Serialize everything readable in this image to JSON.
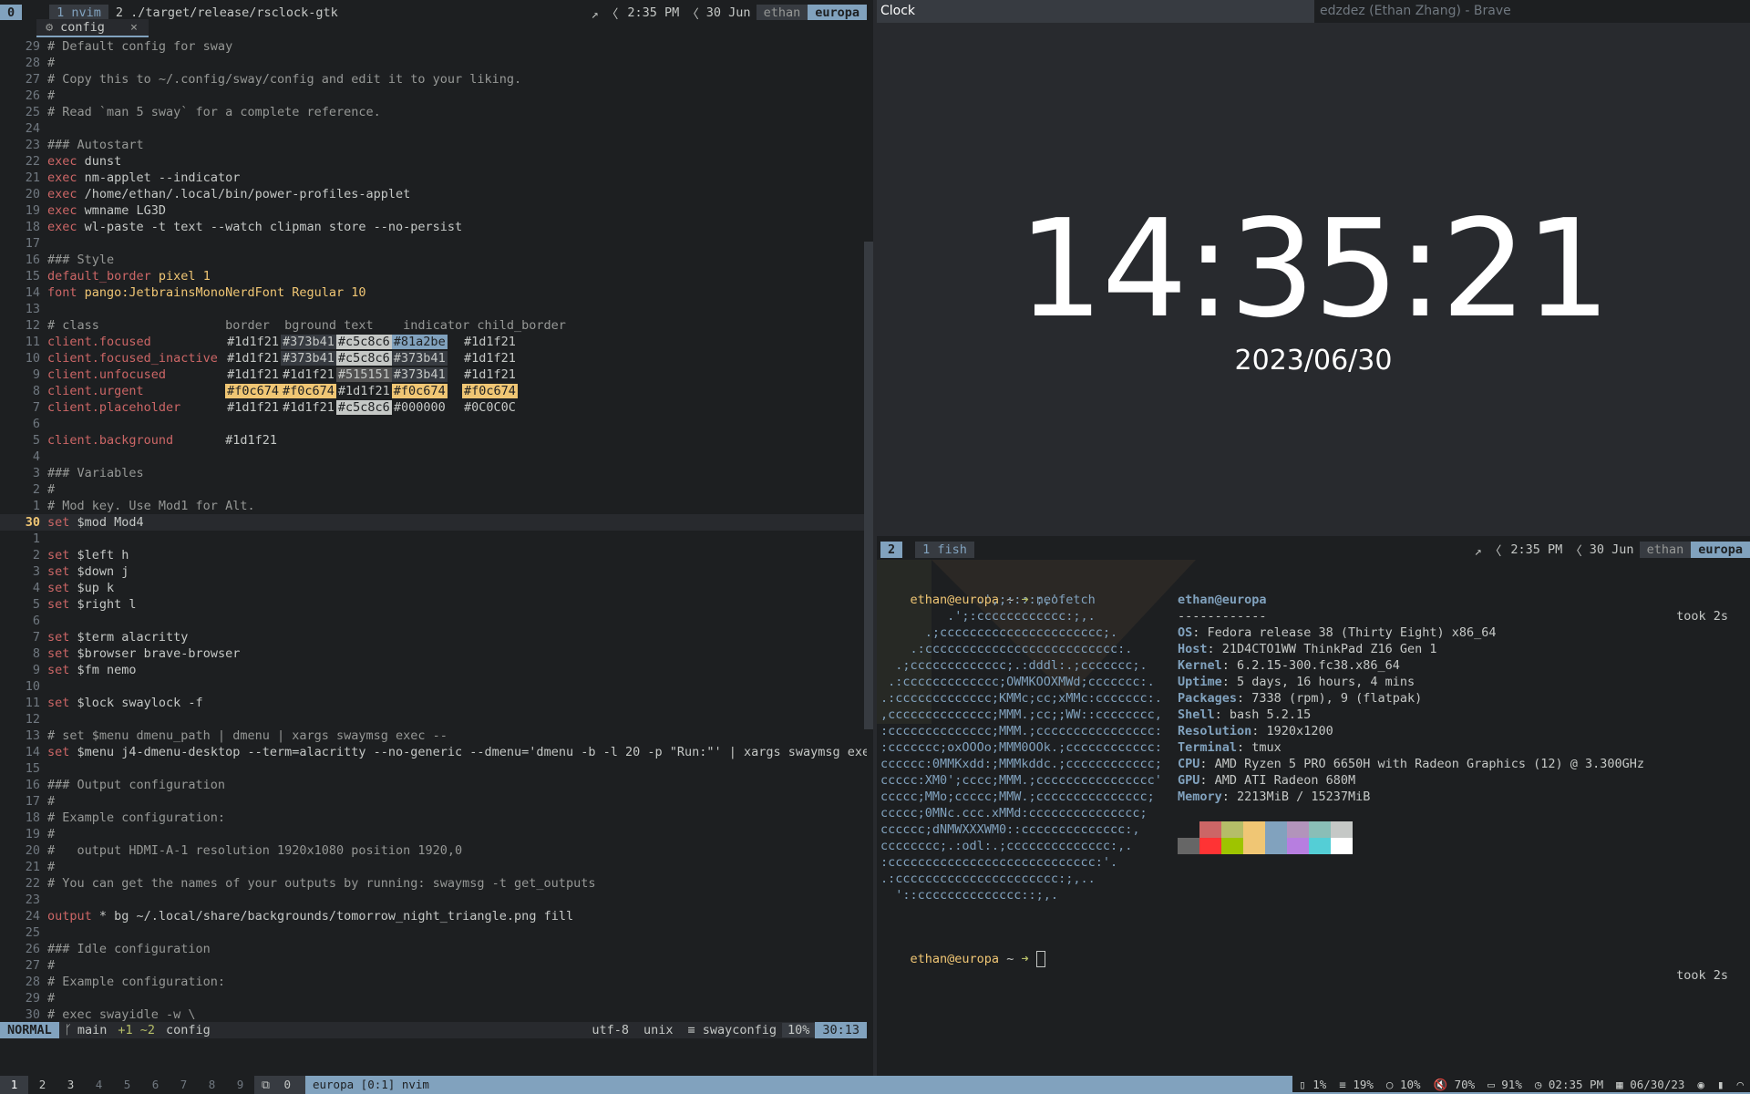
{
  "left_tmux": {
    "session": "0",
    "win1": "1 nvim",
    "win2": "2 ./target/release/rsclock-gtk",
    "time": "2:35 PM",
    "date": "30 Jun",
    "user": "ethan",
    "host": "europa"
  },
  "buffer_tab": {
    "icon": "gear-icon",
    "name": "config",
    "close": "×"
  },
  "code_lines": [
    {
      "n": "29",
      "t": "# Default config for sway",
      "c": "cm"
    },
    {
      "n": "28",
      "t": "#",
      "c": "cm"
    },
    {
      "n": "27",
      "t": "# Copy this to ~/.config/sway/config and edit it to your liking.",
      "c": "cm"
    },
    {
      "n": "26",
      "t": "#",
      "c": "cm"
    },
    {
      "n": "25",
      "t": "# Read `man 5 sway` for a complete reference.",
      "c": "cm"
    },
    {
      "n": "24",
      "t": "",
      "c": "txt"
    },
    {
      "n": "23",
      "t": "### Autostart",
      "c": "cm"
    },
    {
      "n": "22",
      "k": "exec",
      "t": " dunst",
      "c": "txt"
    },
    {
      "n": "21",
      "k": "exec",
      "t": " nm-applet --indicator",
      "c": "txt"
    },
    {
      "n": "20",
      "k": "exec",
      "t": " /home/ethan/.local/bin/power-profiles-applet",
      "c": "txt"
    },
    {
      "n": "19",
      "k": "exec",
      "t": " wmname LG3D",
      "c": "txt"
    },
    {
      "n": "18",
      "k": "exec",
      "t": " wl-paste -t text --watch clipman store --no-persist",
      "c": "txt"
    },
    {
      "n": "17",
      "t": "",
      "c": "txt"
    },
    {
      "n": "16",
      "t": "### Style",
      "c": "cm"
    },
    {
      "n": "15",
      "k": "default_border",
      "t": " pixel 1",
      "c": "ty"
    },
    {
      "n": "14",
      "k": "font",
      "t": " pango:JetbrainsMonoNerdFont Regular 10",
      "c": "ty"
    },
    {
      "n": "13",
      "t": "",
      "c": "txt"
    },
    {
      "n": "12",
      "t": "# class                 border  bground text    indicator child_border",
      "c": "cm"
    },
    {
      "n": "11",
      "k": "client.focused",
      "t": "",
      "c": "txt"
    },
    {
      "n": "10",
      "k": "client.focused_inactive",
      "t": "",
      "c": "txt"
    },
    {
      "n": "9",
      "k": "client.unfocused",
      "t": "",
      "c": "txt"
    },
    {
      "n": "8",
      "k": "client.urgent",
      "t": "",
      "c": "txt"
    },
    {
      "n": "7",
      "k": "client.placeholder",
      "t": "",
      "c": "txt"
    },
    {
      "n": "6",
      "t": "",
      "c": "txt"
    },
    {
      "n": "5",
      "k": "client.background",
      "t": "       #1d1f21",
      "c": "txt"
    },
    {
      "n": "4",
      "t": "",
      "c": "txt"
    },
    {
      "n": "3",
      "t": "### Variables",
      "c": "cm"
    },
    {
      "n": "2",
      "t": "#",
      "c": "cm"
    },
    {
      "n": "1",
      "t": "# Mod key. Use Mod1 for Alt.",
      "c": "cm"
    },
    {
      "n": "30",
      "k": "set",
      "t": " $mod Mod4",
      "c": "txt",
      "cur": true
    },
    {
      "n": "1",
      "t": "",
      "c": "txt"
    },
    {
      "n": "2",
      "k": "set",
      "t": " $left h",
      "c": "txt"
    },
    {
      "n": "3",
      "k": "set",
      "t": " $down j",
      "c": "txt"
    },
    {
      "n": "4",
      "k": "set",
      "t": " $up k",
      "c": "txt"
    },
    {
      "n": "5",
      "k": "set",
      "t": " $right l",
      "c": "txt"
    },
    {
      "n": "6",
      "t": "",
      "c": "txt"
    },
    {
      "n": "7",
      "k": "set",
      "t": " $term alacritty",
      "c": "txt"
    },
    {
      "n": "8",
      "k": "set",
      "t": " $browser brave-browser",
      "c": "txt"
    },
    {
      "n": "9",
      "k": "set",
      "t": " $fm nemo",
      "c": "txt"
    },
    {
      "n": "10",
      "t": "",
      "c": "txt"
    },
    {
      "n": "11",
      "k": "set",
      "t": " $lock swaylock -f",
      "c": "txt"
    },
    {
      "n": "12",
      "t": "",
      "c": "txt"
    },
    {
      "n": "13",
      "t": "# set $menu dmenu_path | dmenu | xargs swaymsg exec --",
      "c": "cm"
    },
    {
      "n": "14",
      "k": "set",
      "t": " $menu j4-dmenu-desktop --term=alacritty --no-generic --dmenu='dmenu -b -l 20 -p \"Run:\"' | xargs swaymsg exec",
      "c": "txt"
    },
    {
      "n": "15",
      "t": "",
      "c": "txt"
    },
    {
      "n": "16",
      "t": "### Output configuration",
      "c": "cm"
    },
    {
      "n": "17",
      "t": "#",
      "c": "cm"
    },
    {
      "n": "18",
      "t": "# Example configuration:",
      "c": "cm"
    },
    {
      "n": "19",
      "t": "#",
      "c": "cm"
    },
    {
      "n": "20",
      "t": "#   output HDMI-A-1 resolution 1920x1080 position 1920,0",
      "c": "cm"
    },
    {
      "n": "21",
      "t": "#",
      "c": "cm"
    },
    {
      "n": "22",
      "t": "# You can get the names of your outputs by running: swaymsg -t get_outputs",
      "c": "cm"
    },
    {
      "n": "23",
      "t": "",
      "c": "txt"
    },
    {
      "n": "24",
      "k": "output",
      "t": " * bg ~/.local/share/backgrounds/tomorrow_night_triangle.png fill",
      "c": "txt"
    },
    {
      "n": "25",
      "t": "",
      "c": "txt"
    },
    {
      "n": "26",
      "t": "### Idle configuration",
      "c": "cm"
    },
    {
      "n": "27",
      "t": "#",
      "c": "cm"
    },
    {
      "n": "28",
      "t": "# Example configuration:",
      "c": "cm"
    },
    {
      "n": "29",
      "t": "#",
      "c": "cm"
    },
    {
      "n": "30",
      "t": "# exec swayidle -w \\",
      "c": "cm"
    }
  ],
  "color_table": [
    {
      "row": "client.focused",
      "cols": [
        {
          "v": "#1d1f21"
        },
        {
          "v": "#373b41",
          "bg": "#373b41",
          "fg": "#c5c8c6"
        },
        {
          "v": "#c5c8c6",
          "bg": "#c5c8c6",
          "fg": "#1d1f21"
        },
        {
          "v": "#81a2be",
          "bg": "#81a2be",
          "fg": "#1d1f21"
        },
        {
          "v": "#1d1f21"
        }
      ]
    },
    {
      "row": "client.focused_inactive",
      "cols": [
        {
          "v": "#1d1f21"
        },
        {
          "v": "#373b41",
          "bg": "#373b41",
          "fg": "#c5c8c6"
        },
        {
          "v": "#c5c8c6",
          "bg": "#c5c8c6",
          "fg": "#1d1f21"
        },
        {
          "v": "#373b41",
          "bg": "#373b41",
          "fg": "#c5c8c6"
        },
        {
          "v": "#1d1f21"
        }
      ]
    },
    {
      "row": "client.unfocused",
      "cols": [
        {
          "v": "#1d1f21"
        },
        {
          "v": "#1d1f21"
        },
        {
          "v": "#515151",
          "bg": "#515151",
          "fg": "#c5c8c6"
        },
        {
          "v": "#373b41",
          "bg": "#373b41",
          "fg": "#c5c8c6"
        },
        {
          "v": "#1d1f21"
        }
      ]
    },
    {
      "row": "client.urgent",
      "cols": [
        {
          "v": "#f0c674",
          "bg": "#f0c674",
          "fg": "#1d1f21"
        },
        {
          "v": "#f0c674",
          "bg": "#f0c674",
          "fg": "#1d1f21"
        },
        {
          "v": "#1d1f21"
        },
        {
          "v": "#f0c674",
          "bg": "#f0c674",
          "fg": "#1d1f21"
        },
        {
          "v": "#f0c674",
          "bg": "#f0c674",
          "fg": "#1d1f21"
        }
      ]
    },
    {
      "row": "client.placeholder",
      "cols": [
        {
          "v": "#1d1f21"
        },
        {
          "v": "#1d1f21"
        },
        {
          "v": "#c5c8c6",
          "bg": "#c5c8c6",
          "fg": "#1d1f21"
        },
        {
          "v": "#000000"
        },
        {
          "v": "#0C0C0C"
        }
      ]
    }
  ],
  "statusline": {
    "mode": "NORMAL",
    "branch": "main",
    "diff": "+1 ~2",
    "file": "config",
    "encoding": "utf-8",
    "format": "unix",
    "filetype": "swayconfig",
    "percent": "10%",
    "position": "30:13"
  },
  "clock_window": {
    "title": "Clock",
    "other_title": "edzdez (Ethan Zhang) - Brave",
    "time": "14:35:21",
    "date": "2023/06/30"
  },
  "right_tmux": {
    "session": "2",
    "win1": "1 fish",
    "time": "2:35 PM",
    "date": "30 Jun",
    "user": "ethan",
    "host": "europa"
  },
  "terminal": {
    "prompt1_user": "ethan@europa",
    "prompt1_dir": " ~ ",
    "prompt1_cmd": "neofetch",
    "took": "took 2s",
    "ascii": [
      "             .',;::::;,'.",
      "         .';:cccccccccccc:;,.",
      "      .;cccccccccccccccccccccc;.",
      "    .:cccccccccccccccccccccccccc:.",
      "  .;ccccccccccccc;.:dddl:.;ccccccc;.",
      " .:ccccccccccccc;OWMKOOXMWd;ccccccc:.",
      ".:ccccccccccccc;KMMc;cc;xMMc:ccccccc:.",
      ",cccccccccccccc;MMM.;cc;;WW::cccccccc,",
      ":cccccccccccccc;MMM.;cccccccccccccccc:",
      ":ccccccc;oxOOOo;MMM0OOk.;cccccccccccc:",
      "cccccc:0MMKxdd:;MMMkddc.;cccccccccccc;",
      "ccccc:XM0';cccc;MMM.;cccccccccccccccc'",
      "ccccc;MMo;ccccc;MMW.;ccccccccccccccc;",
      "ccccc;0MNc.ccc.xMMd:ccccccccccccccc;",
      "cccccc;dNMWXXXWM0::cccccccccccccc:,",
      "cccccccc;.:odl:.;cccccccccccccc:,.",
      ":cccccccccccccccccccccccccccc:'.",
      ".:cccccccccccccccccccccc:;,..",
      "  '::cccccccccccccc::;,."
    ],
    "info_title": "ethan@europa",
    "info_sep": "------------",
    "info": [
      {
        "k": "OS",
        "v": " Fedora release 38 (Thirty Eight) x86_64"
      },
      {
        "k": "Host",
        "v": " 21D4CTO1WW ThinkPad Z16 Gen 1"
      },
      {
        "k": "Kernel",
        "v": " 6.2.15-300.fc38.x86_64"
      },
      {
        "k": "Uptime",
        "v": " 5 days, 16 hours, 4 mins"
      },
      {
        "k": "Packages",
        "v": " 7338 (rpm), 9 (flatpak)"
      },
      {
        "k": "Shell",
        "v": " bash 5.2.15"
      },
      {
        "k": "Resolution",
        "v": " 1920x1200"
      },
      {
        "k": "Terminal",
        "v": " tmux"
      },
      {
        "k": "CPU",
        "v": " AMD Ryzen 5 PRO 6650H with Radeon Graphics (12) @ 3.300GHz"
      },
      {
        "k": "GPU",
        "v": " AMD ATI Radeon 680M"
      },
      {
        "k": "Memory",
        "v": " 2213MiB / 15237MiB"
      }
    ],
    "palette_top": [
      "#1d1f21",
      "#cc6666",
      "#b5bd68",
      "#f0c674",
      "#81a2be",
      "#b294bb",
      "#8abeb7",
      "#c5c8c6"
    ],
    "palette_bottom": [
      "#666666",
      "#ff3334",
      "#9ec400",
      "#f0c674",
      "#81a2be",
      "#b77ee0",
      "#54ced6",
      "#ffffff"
    ],
    "prompt2_user": "ethan@europa",
    "prompt2_dir": " ~ ",
    "took2": "took 2s"
  },
  "swaybar": {
    "workspaces": [
      "1",
      "2",
      "3",
      "4",
      "5",
      "6",
      "7",
      "8",
      "9"
    ],
    "active_ws": "1",
    "tmux_icon": "window-icon",
    "tmux_num": "0",
    "tmux_text": "europa [0:1] nvim",
    "tray": [
      {
        "icon": "disk-icon",
        "v": "1%"
      },
      {
        "icon": "cpu-icon",
        "v": "19%"
      },
      {
        "icon": "memory-icon",
        "v": "10%"
      },
      {
        "icon": "speaker-mute-icon",
        "v": "70%"
      },
      {
        "icon": "battery-icon",
        "v": "91%"
      },
      {
        "icon": "clock-icon",
        "v": "02:35 PM"
      },
      {
        "icon": "calendar-icon",
        "v": "06/30/23"
      }
    ]
  }
}
